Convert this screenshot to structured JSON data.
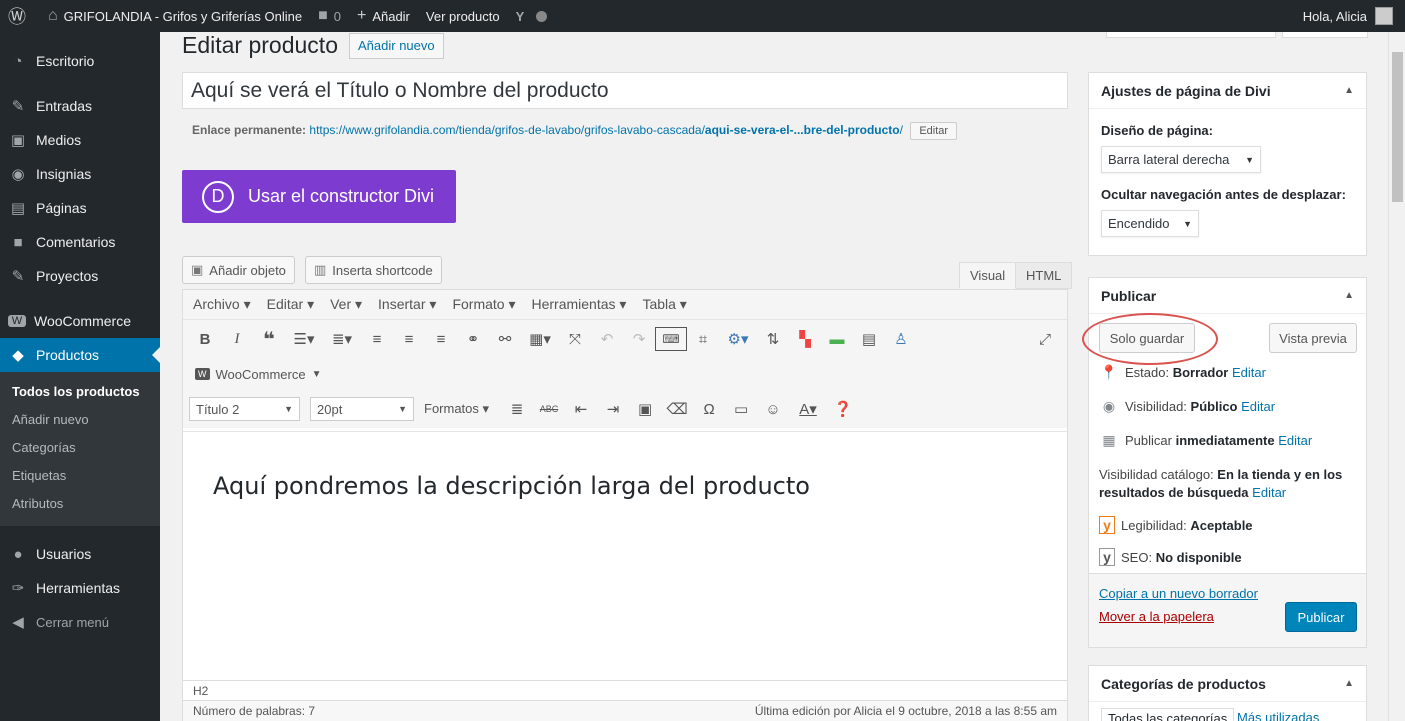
{
  "adminbar": {
    "site_name": "GRIFOLANDIA - Grifos y Griferías Online",
    "comments_count": "0",
    "add_new": "Añadir",
    "view_product": "Ver producto",
    "greeting": "Hola, Alicia"
  },
  "sidebar": {
    "items": [
      {
        "label": "Escritorio",
        "icon": "dashboard-icon"
      },
      {
        "label": "Entradas",
        "icon": "pin-icon"
      },
      {
        "label": "Medios",
        "icon": "media-icon"
      },
      {
        "label": "Insignias",
        "icon": "eye-icon"
      },
      {
        "label": "Páginas",
        "icon": "pages-icon"
      },
      {
        "label": "Comentarios",
        "icon": "comment-icon"
      },
      {
        "label": "Proyectos",
        "icon": "pin-icon"
      },
      {
        "label": "WooCommerce",
        "icon": "woo-icon"
      },
      {
        "label": "Productos",
        "icon": "box-icon"
      },
      {
        "label": "Usuarios",
        "icon": "user-icon"
      },
      {
        "label": "Herramientas",
        "icon": "wrench-icon"
      },
      {
        "label": "Cerrar menú",
        "icon": "collapse-icon"
      }
    ],
    "submenu": [
      "Todos los productos",
      "Añadir nuevo",
      "Categorías",
      "Etiquetas",
      "Atributos"
    ]
  },
  "page": {
    "title": "Editar producto",
    "add_new": "Añadir nuevo",
    "product_title": "Aquí se verá el Título o Nombre del producto",
    "permalink_label": "Enlace permanente:",
    "permalink_base": "https://www.grifolandia.com/tienda/grifos-de-lavabo/grifos-lavabo-cascada/",
    "permalink_slug": "aqui-se-vera-el-...bre-del-producto",
    "permalink_end": "/",
    "permalink_edit": "Editar",
    "divi_button": "Usar el constructor Divi",
    "divi_letter": "D"
  },
  "editor": {
    "add_media": "Añadir objeto",
    "shortcode": "Inserta shortcode",
    "tab_visual": "Visual",
    "tab_html": "HTML",
    "menu": [
      "Archivo ▾",
      "Editar ▾",
      "Ver ▾",
      "Insertar ▾",
      "Formato ▾",
      "Herramientas ▾",
      "Tabla ▾"
    ],
    "woocommerce": "WooCommerce",
    "format_select": "Título 2",
    "size_select": "20pt",
    "formats": "Formatos",
    "content": "Aquí pondremos la descripción larga del producto",
    "path": "H2",
    "word_count": "Número de palabras: 7",
    "last_edit": "Última edición por Alicia el 9 octubre, 2018 a las 8:55 am"
  },
  "divi_box": {
    "title": "Ajustes de página de Divi",
    "layout_label": "Diseño de página:",
    "layout_value": "Barra lateral derecha",
    "nav_label": "Ocultar navegación antes de desplazar:",
    "nav_value": "Encendido"
  },
  "publish": {
    "title": "Publicar",
    "save_draft": "Solo guardar",
    "preview": "Vista previa",
    "status_label": "Estado:",
    "status_value": "Borrador",
    "visibility_label": "Visibilidad:",
    "visibility_value": "Público",
    "publish_label": "Publicar",
    "publish_value": "inmediatamente",
    "catalog_label": "Visibilidad catálogo:",
    "catalog_value1": "En la tienda y en los",
    "catalog_value2": "resultados de búsqueda",
    "readability_label": "Legibilidad:",
    "readability_value": "Aceptable",
    "seo_label": "SEO:",
    "seo_value": "No disponible",
    "edit": "Editar",
    "copy_draft": "Copiar a un nuevo borrador",
    "trash": "Mover a la papelera",
    "publish_button": "Publicar"
  },
  "categories": {
    "title": "Categorías de productos",
    "tab_all": "Todas las categorías",
    "tab_used": "Más utilizadas"
  },
  "colors": {
    "admin_bg": "#23282d",
    "accent": "#0073aa",
    "divi": "#7e3bd0",
    "highlight_circle": "#d9534f"
  }
}
